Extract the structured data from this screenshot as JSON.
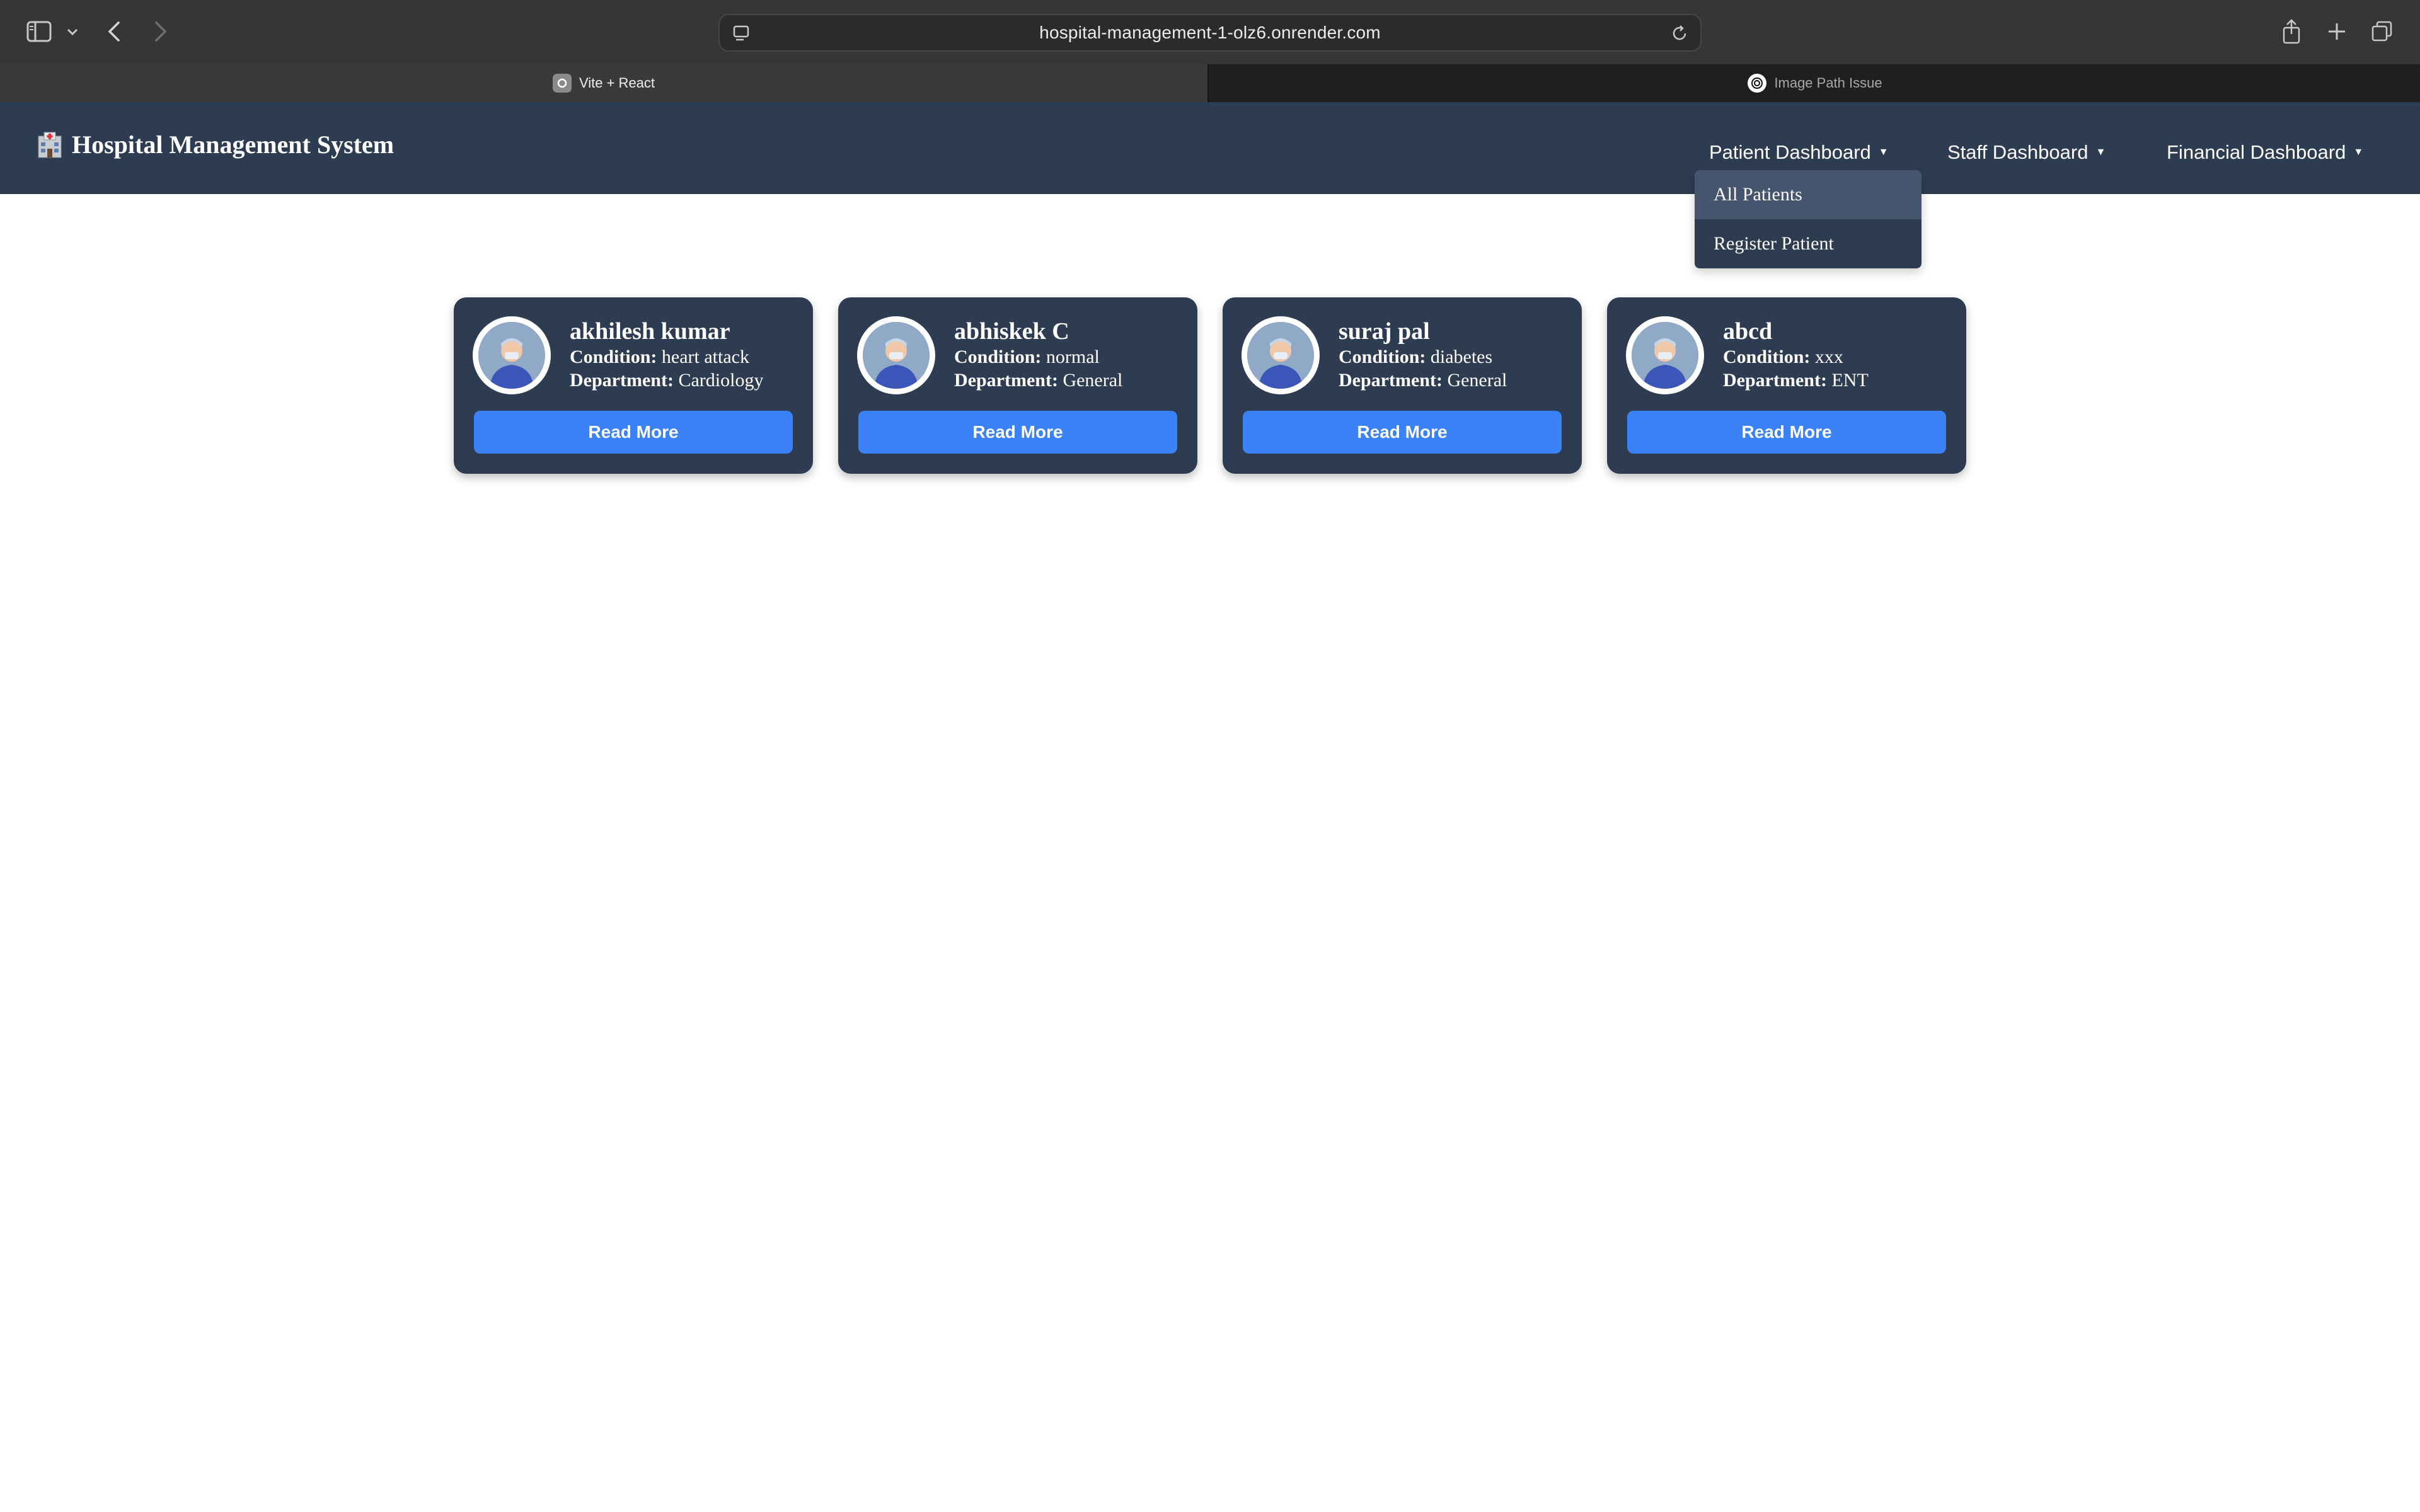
{
  "browser": {
    "url": "hospital-management-1-olz6.onrender.com",
    "tabs": [
      {
        "title": "Vite + React",
        "icon": "vite-icon",
        "active": true
      },
      {
        "title": "Image Path Issue",
        "icon": "chatgpt-icon",
        "active": false
      }
    ]
  },
  "header": {
    "brand_icon": "hospital-emoji-icon",
    "title": "Hospital Management System",
    "nav": [
      {
        "label": "Patient Dashboard"
      },
      {
        "label": "Staff Dashboard"
      },
      {
        "label": "Financial Dashboard"
      }
    ],
    "dropdown": {
      "items": [
        {
          "label": "All Patients",
          "highlighted": true
        },
        {
          "label": "Register Patient",
          "highlighted": false
        }
      ]
    }
  },
  "patients": {
    "labels": {
      "condition": "Condition:",
      "department": "Department:",
      "button": "Read More"
    },
    "items": [
      {
        "name": "akhilesh kumar",
        "condition": "heart attack",
        "department": "Cardiology"
      },
      {
        "name": "abhiskek C",
        "condition": "normal",
        "department": "General"
      },
      {
        "name": "suraj pal",
        "condition": "diabetes",
        "department": "General"
      },
      {
        "name": "abcd",
        "condition": "xxx",
        "department": "ENT"
      }
    ]
  },
  "colors": {
    "header_bg": "#2e3c52",
    "card_bg": "#2e3c52",
    "button": "#3b82f6",
    "dropdown_hover": "#45556e"
  }
}
